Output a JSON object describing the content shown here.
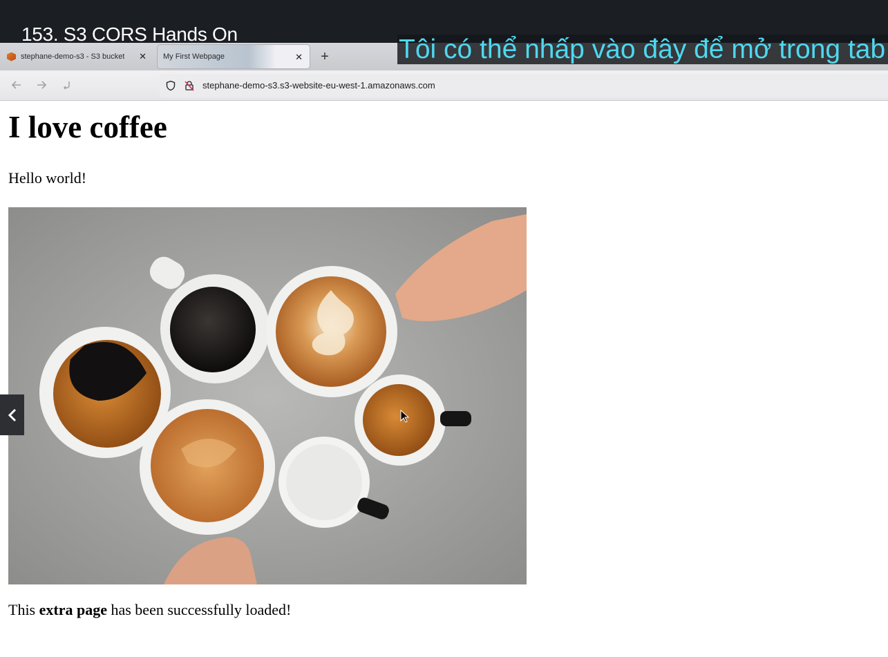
{
  "video": {
    "title": "153. S3 CORS Hands On"
  },
  "subtitle": {
    "text": "Tôi có thể nhấp vào đây để mở trong tab"
  },
  "browser": {
    "tabs": [
      {
        "label": "stephane-demo-s3 - S3 bucket",
        "active": false,
        "icon": "aws-s3-bucket-icon"
      },
      {
        "label": "My First Webpage",
        "active": true,
        "icon": null
      }
    ],
    "new_tab": "+",
    "nav": {
      "back": "back-arrow-icon",
      "forward": "forward-arrow-icon",
      "reload": "reload-icon"
    },
    "url": "stephane-demo-s3.s3-website-eu-west-1.amazonaws.com"
  },
  "page": {
    "heading": "I love coffee",
    "paragraph": "Hello world!",
    "image": {
      "icon": "coffee-cups-photo"
    },
    "footer_prefix": "This ",
    "footer_bold": "extra page",
    "footer_suffix": " has been successfully loaded!"
  },
  "colors": {
    "subtitle": "#4fd8ef",
    "video_bar": "#1b1e23"
  }
}
